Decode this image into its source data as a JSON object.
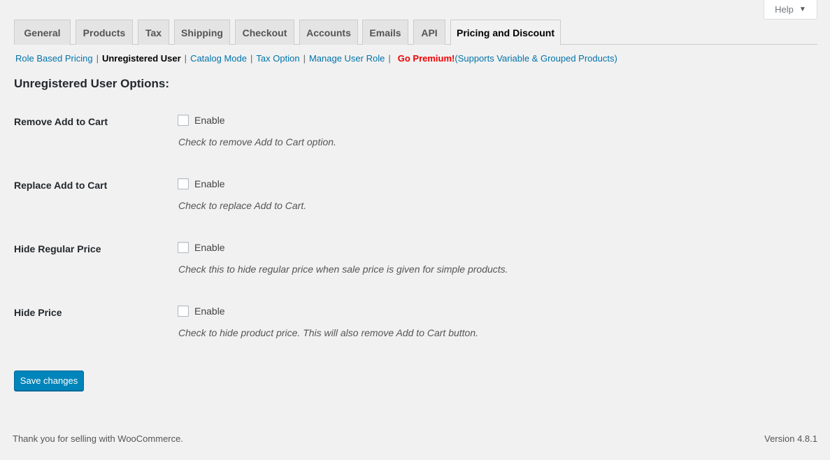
{
  "help": {
    "label": "Help",
    "caret": "▼",
    "caret_icon": "triangle-down-icon"
  },
  "tabs": [
    {
      "label": "General"
    },
    {
      "label": "Products"
    },
    {
      "label": "Tax"
    },
    {
      "label": "Shipping"
    },
    {
      "label": "Checkout"
    },
    {
      "label": "Accounts"
    },
    {
      "label": "Emails"
    },
    {
      "label": "API"
    },
    {
      "label": "Pricing and Discount",
      "active": true
    }
  ],
  "sublinks": {
    "role_based": "Role Based Pricing",
    "unregistered": "Unregistered User",
    "catalog": "Catalog Mode",
    "tax_option": "Tax Option",
    "manage_role": "Manage User Role",
    "separator": "|",
    "premium": "Go Premium!",
    "premium_note": "(Supports Variable & Grouped Products)"
  },
  "section_title": "Unregistered User Options:",
  "options": [
    {
      "label": "Remove Add to Cart",
      "enable": "Enable",
      "checked": false,
      "description": "Check to remove Add to Cart option."
    },
    {
      "label": "Replace Add to Cart",
      "enable": "Enable",
      "checked": false,
      "description": "Check to replace Add to Cart."
    },
    {
      "label": "Hide Regular Price",
      "enable": "Enable",
      "checked": false,
      "description": "Check this to hide regular price when sale price is given for simple products."
    },
    {
      "label": "Hide Price",
      "enable": "Enable",
      "checked": false,
      "description": "Check to hide product price. This will also remove Add to Cart button."
    }
  ],
  "save_label": "Save changes",
  "footer": {
    "thanks": "Thank you for selling with WooCommerce.",
    "version": "Version 4.8.1"
  },
  "colors": {
    "link": "#0073aa",
    "premium": "#ee0000",
    "primary_button": "#0085ba",
    "background": "#f1f1f1"
  }
}
